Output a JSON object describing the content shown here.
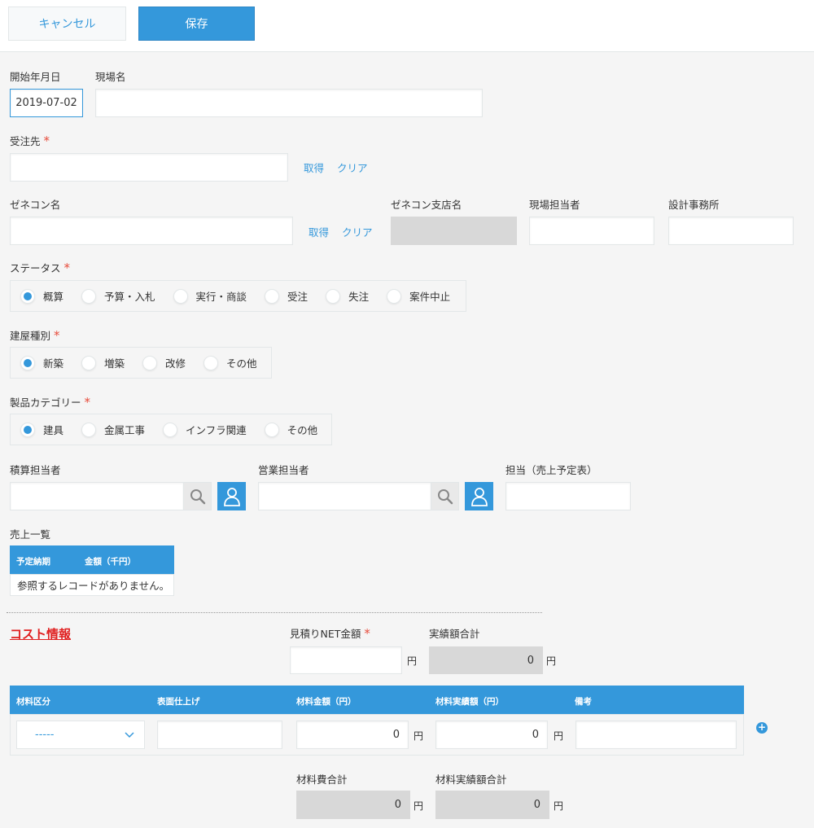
{
  "toolbar": {
    "cancel_label": "キャンセル",
    "save_label": "保存"
  },
  "fields": {
    "start_date": {
      "label": "開始年月日",
      "value": "2019-07-02"
    },
    "site_name": {
      "label": "現場名",
      "value": ""
    },
    "client": {
      "label": "受注先",
      "required_mark": "*",
      "value": "",
      "get_label": "取得",
      "clear_label": "クリア"
    },
    "general_contractor": {
      "label": "ゼネコン名",
      "value": "",
      "get_label": "取得",
      "clear_label": "クリア"
    },
    "gc_branch": {
      "label": "ゼネコン支店名",
      "value": ""
    },
    "site_manager": {
      "label": "現場担当者",
      "value": ""
    },
    "design_office": {
      "label": "設計事務所",
      "value": ""
    },
    "status": {
      "label": "ステータス",
      "required_mark": "*",
      "options": [
        "概算",
        "予算・入札",
        "実行・商談",
        "受注",
        "失注",
        "案件中止"
      ],
      "selected": "概算"
    },
    "building_type": {
      "label": "建屋種別",
      "required_mark": "*",
      "options": [
        "新築",
        "増築",
        "改修",
        "その他"
      ],
      "selected": "新築"
    },
    "product_category": {
      "label": "製品カテゴリー",
      "required_mark": "*",
      "options": [
        "建具",
        "金属工事",
        "インフラ関連",
        "その他"
      ],
      "selected": "建具"
    },
    "estimator": {
      "label": "積算担当者",
      "value": ""
    },
    "sales_rep": {
      "label": "営業担当者",
      "value": ""
    },
    "assignee": {
      "label": "担当（売上予定表）",
      "value": ""
    }
  },
  "sales_list": {
    "label": "売上一覧",
    "columns": [
      "予定納期",
      "金額（千円）"
    ],
    "empty_message": "参照するレコードがありません。"
  },
  "cost": {
    "section_title": "コスト情報",
    "net_estimate": {
      "label": "見積りNET金額",
      "required_mark": "*",
      "value": "",
      "unit": "円"
    },
    "actual_total": {
      "label": "実績額合計",
      "value": "0",
      "unit": "円"
    },
    "table": {
      "columns": [
        "材料区分",
        "表面仕上げ",
        "材料金額（円）",
        "材料実績額（円）",
        "備考"
      ],
      "row": {
        "category": "-----",
        "finish": "",
        "amount": "0",
        "amount_unit": "円",
        "actual": "0",
        "actual_unit": "円",
        "note": ""
      },
      "add_label": "+"
    },
    "material_total": {
      "label": "材料費合計",
      "value": "0",
      "unit": "円"
    },
    "material_actual_total": {
      "label": "材料実績額合計",
      "value": "0",
      "unit": "円"
    }
  },
  "colors": {
    "accent": "#3498db",
    "required": "#e74c3c",
    "section_title": "#e01f1f",
    "disabled": "#d8d8d8"
  }
}
